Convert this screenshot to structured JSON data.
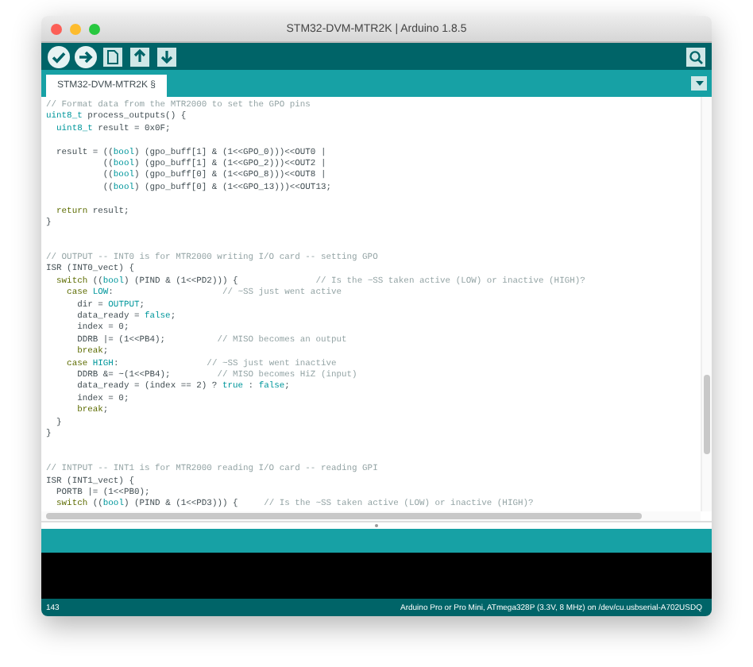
{
  "window": {
    "title": "STM32-DVM-MTR2K | Arduino 1.8.5"
  },
  "toolbar": {
    "buttons": [
      {
        "kind": "verify"
      },
      {
        "kind": "upload"
      },
      {
        "kind": "new"
      },
      {
        "kind": "open"
      },
      {
        "kind": "save"
      }
    ],
    "right_button": {
      "kind": "serial"
    }
  },
  "tabs": [
    {
      "label": "STM32-DVM-MTR2K §",
      "selected": true
    }
  ],
  "editor": {
    "lines": [
      {
        "kind": "code",
        "segments": [
          {
            "kind": "comment",
            "text": "// Format data from the MTR2000 to set the GPO pins"
          }
        ]
      },
      {
        "kind": "code",
        "segments": [
          {
            "kind": "type",
            "text": "uint8_t"
          },
          {
            "kind": "plain",
            "text": " process_outputs() {"
          }
        ]
      },
      {
        "kind": "code",
        "segments": [
          {
            "kind": "type",
            "text": "  uint8_t"
          },
          {
            "kind": "plain",
            "text": " result = 0x0F;"
          }
        ]
      },
      {
        "kind": "blank"
      },
      {
        "kind": "code",
        "segments": [
          {
            "kind": "plain",
            "text": "  result = (("
          },
          {
            "kind": "const",
            "text": "bool"
          },
          {
            "kind": "plain",
            "text": ") (gpo_buff[1] & (1<<GPO_0)))<<OUT0 |"
          }
        ]
      },
      {
        "kind": "code",
        "segments": [
          {
            "kind": "plain",
            "text": "           (("
          },
          {
            "kind": "const",
            "text": "bool"
          },
          {
            "kind": "plain",
            "text": ") (gpo_buff[1] & (1<<GPO_2)))<<OUT2 |"
          }
        ]
      },
      {
        "kind": "code",
        "segments": [
          {
            "kind": "plain",
            "text": "           (("
          },
          {
            "kind": "const",
            "text": "bool"
          },
          {
            "kind": "plain",
            "text": ") (gpo_buff[0] & (1<<GPO_8)))<<OUT8 |"
          }
        ]
      },
      {
        "kind": "code",
        "segments": [
          {
            "kind": "plain",
            "text": "           (("
          },
          {
            "kind": "const",
            "text": "bool"
          },
          {
            "kind": "plain",
            "text": ") (gpo_buff[0] & (1<<GPO_13)))<<OUT13;"
          }
        ]
      },
      {
        "kind": "blank"
      },
      {
        "kind": "code",
        "segments": [
          {
            "kind": "keyword",
            "text": "  return"
          },
          {
            "kind": "plain",
            "text": " result;"
          }
        ]
      },
      {
        "kind": "code",
        "segments": [
          {
            "kind": "plain",
            "text": "}"
          }
        ]
      },
      {
        "kind": "blank"
      },
      {
        "kind": "blank"
      },
      {
        "kind": "code",
        "segments": [
          {
            "kind": "comment",
            "text": "// OUTPUT -- INT0 is for MTR2000 writing I/O card -- setting GPO"
          }
        ]
      },
      {
        "kind": "code",
        "segments": [
          {
            "kind": "plain",
            "text": "ISR (INT0_vect) {"
          }
        ]
      },
      {
        "kind": "code",
        "segments": [
          {
            "kind": "keyword",
            "text": "  switch"
          },
          {
            "kind": "plain",
            "text": " (("
          },
          {
            "kind": "const",
            "text": "bool"
          },
          {
            "kind": "plain",
            "text": ") (PIND & (1<<PD2))) {"
          },
          {
            "kind": "comment",
            "text": "               // Is the ~SS taken active (LOW) or inactive (HIGH)?"
          }
        ]
      },
      {
        "kind": "code",
        "segments": [
          {
            "kind": "keyword",
            "text": "    case"
          },
          {
            "kind": "const",
            "text": " LOW"
          },
          {
            "kind": "plain",
            "text": ":"
          },
          {
            "kind": "comment",
            "text": "                     // ~SS just went active"
          }
        ]
      },
      {
        "kind": "code",
        "segments": [
          {
            "kind": "plain",
            "text": "      dir = "
          },
          {
            "kind": "const",
            "text": "OUTPUT"
          },
          {
            "kind": "plain",
            "text": ";"
          }
        ]
      },
      {
        "kind": "code",
        "segments": [
          {
            "kind": "plain",
            "text": "      data_ready = "
          },
          {
            "kind": "const",
            "text": "false"
          },
          {
            "kind": "plain",
            "text": ";"
          }
        ]
      },
      {
        "kind": "code",
        "segments": [
          {
            "kind": "plain",
            "text": "      index = 0;"
          }
        ]
      },
      {
        "kind": "code",
        "segments": [
          {
            "kind": "plain",
            "text": "      DDRB |= (1<<PB4);"
          },
          {
            "kind": "comment",
            "text": "          // MISO becomes an output"
          }
        ]
      },
      {
        "kind": "code",
        "segments": [
          {
            "kind": "keyword",
            "text": "      break"
          },
          {
            "kind": "plain",
            "text": ";"
          }
        ]
      },
      {
        "kind": "code",
        "segments": [
          {
            "kind": "keyword",
            "text": "    case"
          },
          {
            "kind": "const",
            "text": " HIGH"
          },
          {
            "kind": "plain",
            "text": ":"
          },
          {
            "kind": "comment",
            "text": "                 // ~SS just went inactive"
          }
        ]
      },
      {
        "kind": "code",
        "segments": [
          {
            "kind": "plain",
            "text": "      DDRB &= ~(1<<PB4);"
          },
          {
            "kind": "comment",
            "text": "         // MISO becomes HiZ (input)"
          }
        ]
      },
      {
        "kind": "code",
        "segments": [
          {
            "kind": "plain",
            "text": "      data_ready = (index == 2) ? "
          },
          {
            "kind": "const",
            "text": "true"
          },
          {
            "kind": "plain",
            "text": " : "
          },
          {
            "kind": "const",
            "text": "false"
          },
          {
            "kind": "plain",
            "text": ";"
          }
        ]
      },
      {
        "kind": "code",
        "segments": [
          {
            "kind": "plain",
            "text": "      index = 0;"
          }
        ]
      },
      {
        "kind": "code",
        "segments": [
          {
            "kind": "keyword",
            "text": "      break"
          },
          {
            "kind": "plain",
            "text": ";"
          }
        ]
      },
      {
        "kind": "code",
        "segments": [
          {
            "kind": "plain",
            "text": "  }"
          }
        ]
      },
      {
        "kind": "code",
        "segments": [
          {
            "kind": "plain",
            "text": "}"
          }
        ]
      },
      {
        "kind": "blank"
      },
      {
        "kind": "blank"
      },
      {
        "kind": "code",
        "segments": [
          {
            "kind": "comment",
            "text": "// INTPUT -- INT1 is for MTR2000 reading I/O card -- reading GPI"
          }
        ]
      },
      {
        "kind": "code",
        "segments": [
          {
            "kind": "plain",
            "text": "ISR (INT1_vect) {"
          }
        ]
      },
      {
        "kind": "code",
        "segments": [
          {
            "kind": "plain",
            "text": "  PORTB |= (1<<PB0);"
          }
        ]
      },
      {
        "kind": "code",
        "segments": [
          {
            "kind": "keyword",
            "text": "  switch"
          },
          {
            "kind": "plain",
            "text": " (("
          },
          {
            "kind": "const",
            "text": "bool"
          },
          {
            "kind": "plain",
            "text": ") (PIND & (1<<PD3))) {"
          },
          {
            "kind": "comment",
            "text": "     // Is the ~SS taken active (LOW) or inactive (HIGH)?"
          }
        ]
      }
    ]
  },
  "status_bar": {
    "line": "143",
    "board": "Arduino Pro or Pro Mini, ATmega328P (3.3V, 8 MHz) on /dev/cu.usbserial-A702USDQ"
  }
}
